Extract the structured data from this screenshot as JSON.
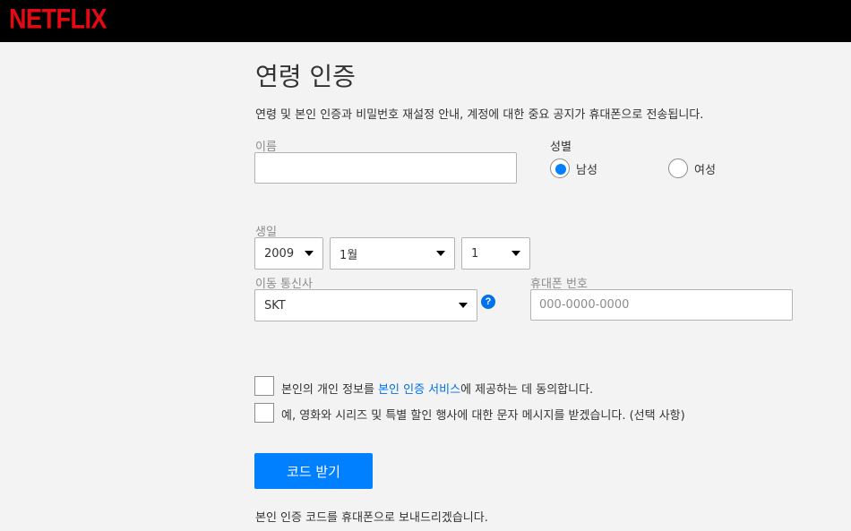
{
  "header": {
    "logo": "NETFLIX"
  },
  "page": {
    "title": "연령 인증",
    "description": "연령 및 본인 인증과 비밀번호 재설정 안내, 계정에 대한 중요 공지가 휴대폰으로 전송됩니다."
  },
  "form": {
    "name_label": "이름",
    "name_value": "",
    "gender_label": "성별",
    "gender_options": [
      "남성",
      "여성"
    ],
    "gender_selected": "남성",
    "birth_label": "생일",
    "birth_year": "2009",
    "birth_month": "1월",
    "birth_day": "1",
    "carrier_label": "이동 통신사",
    "carrier_value": "SKT",
    "help_glyph": "?",
    "phone_label": "휴대폰 번호",
    "phone_placeholder": "000-0000-0000",
    "consent_1_prefix": "본인의 개인 정보를 ",
    "consent_1_link": "본인 인증 서비스",
    "consent_1_suffix": "에 제공하는 데 동의합니다.",
    "consent_2": "예, 영화와 시리즈 및 특별 할인 행사에 대한 문자 메시지를 받겠습니다. (선택 사항)",
    "submit_label": "코드 받기",
    "footnote": "본인 인증 코드를 휴대폰으로 보내드리겠습니다."
  },
  "colors": {
    "brand": "#e50914",
    "accent": "#0080ff",
    "link": "#0071eb"
  }
}
